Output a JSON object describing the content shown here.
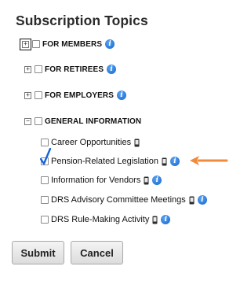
{
  "page": {
    "title": "Subscription Topics"
  },
  "categories": [
    {
      "label": "FOR MEMBERS",
      "expander": "+"
    },
    {
      "label": "FOR RETIREES",
      "expander": "+"
    },
    {
      "label": "FOR EMPLOYERS",
      "expander": "+"
    },
    {
      "label": "GENERAL INFORMATION",
      "expander": "−"
    }
  ],
  "general_items": [
    {
      "label": "Career Opportunities",
      "checked": false,
      "has_info": false
    },
    {
      "label": "Pension-Related Legislation",
      "checked": true,
      "has_info": true
    },
    {
      "label": "Information for Vendors",
      "checked": false,
      "has_info": true
    },
    {
      "label": "DRS Advisory Committee Meetings",
      "checked": false,
      "has_info": true
    },
    {
      "label": "DRS Rule-Making Activity",
      "checked": false,
      "has_info": true
    }
  ],
  "icons": {
    "info": "info-icon",
    "phone": "mobile-phone-icon",
    "arrow": "orange-arrow-left-icon"
  },
  "info_glyph": "i",
  "colors": {
    "info_blue": "#1d6fd8",
    "check_blue": "#1565d8",
    "arrow_orange": "#f08a3c"
  },
  "buttons": {
    "submit": "Submit",
    "cancel": "Cancel"
  }
}
